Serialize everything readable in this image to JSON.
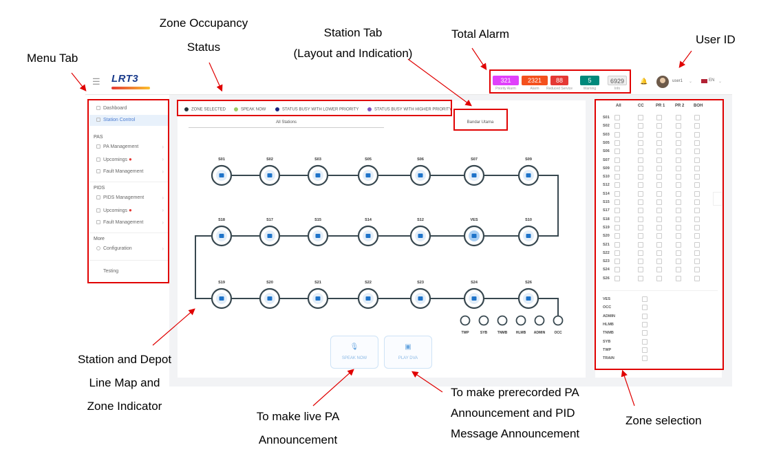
{
  "annotations": {
    "menu_tab": "Menu Tab",
    "zone_occupancy_line1": "Zone Occupancy",
    "zone_occupancy_line2": "Status",
    "station_tab_line1": "Station Tab",
    "station_tab_line2": "(Layout and Indication)",
    "total_alarm": "Total Alarm",
    "user_id": "User ID",
    "line_map_line1": "Station and Depot",
    "line_map_line2": "Line Map and",
    "line_map_line3": "Zone Indicator",
    "live_pa_line1": "To make live PA",
    "live_pa_line2": "Announcement",
    "prerecorded_line1": "To make prerecorded PA",
    "prerecorded_line2": "Announcement and PID",
    "prerecorded_line3": "Message Announcement",
    "zone_selection": "Zone selection"
  },
  "header": {
    "menu_icon": "hamburger-icon",
    "logo_text": "LRT3",
    "alarms": [
      {
        "value": "321",
        "label": "Priority Alarm",
        "color": "#e040fb"
      },
      {
        "value": "2321",
        "label": "Alarm",
        "color": "#f4511e"
      },
      {
        "value": "88",
        "label": "Reduced Service",
        "color": "#e53935"
      },
      {
        "value": "5",
        "label": "Warning",
        "color": "#00897b"
      },
      {
        "value": "6929",
        "label": "Info",
        "color": "#eeeeee"
      }
    ],
    "bell_icon": "bell-icon",
    "username": "user1",
    "language": "EN"
  },
  "sidebar": {
    "items": [
      {
        "label": "Dashboard",
        "icon": "home-icon"
      },
      {
        "label": "Station Control",
        "icon": "monitor-icon"
      }
    ],
    "pas": {
      "title": "PAS",
      "items": [
        {
          "label": "PA Management"
        },
        {
          "label": "Upcomings"
        },
        {
          "label": "Fault Management"
        }
      ]
    },
    "pids": {
      "title": "PIDS",
      "items": [
        {
          "label": "PIDS Management"
        },
        {
          "label": "Upcomings"
        },
        {
          "label": "Fault Management"
        }
      ]
    },
    "more": {
      "title": "More",
      "items": [
        {
          "label": "Configuration"
        },
        {
          "label": "Testing"
        }
      ]
    }
  },
  "legend": [
    {
      "label": "ZONE SELECTED",
      "color": "#263238"
    },
    {
      "label": "SPEAK NOW",
      "color": "#9ccc65"
    },
    {
      "label": "STATUS BUSY WITH LOWER PRIORITY",
      "color": "#1a237e"
    },
    {
      "label": "STATUS BUSY WITH HIGHER PRIORITY",
      "color": "#7e57c2"
    }
  ],
  "tabs": {
    "all_stations": "All Stations",
    "bandar_utama": "Bandar Utama"
  },
  "line_map": {
    "row1": [
      "S01",
      "S02",
      "S03",
      "S05",
      "S06",
      "S07",
      "S09"
    ],
    "row2": [
      "S18",
      "S17",
      "S15",
      "S14",
      "S12",
      "VES",
      "S10"
    ],
    "row3": [
      "S19",
      "S20",
      "S21",
      "S22",
      "S23",
      "S24",
      "S26"
    ],
    "depot": [
      "TWP",
      "SYB",
      "TNMB",
      "HLMB",
      "ADMIN",
      "OCC"
    ]
  },
  "actions": {
    "speak_now": "SPEAK NOW",
    "play_dva": "PLAY DVA"
  },
  "zone_panel": {
    "headers": [
      "All",
      "CC",
      "PR 1",
      "PR 2",
      "BOH"
    ],
    "stations": [
      "S01",
      "S02",
      "S03",
      "S05",
      "S06",
      "S07",
      "S09",
      "S10",
      "S12",
      "S14",
      "S15",
      "S17",
      "S18",
      "S19",
      "S20",
      "S21",
      "S22",
      "S23",
      "S24",
      "S26"
    ],
    "others": [
      "VES",
      "OCC",
      "ADMIN",
      "HLMB",
      "TNMB",
      "SYB",
      "TWP",
      "TRAIN"
    ]
  }
}
